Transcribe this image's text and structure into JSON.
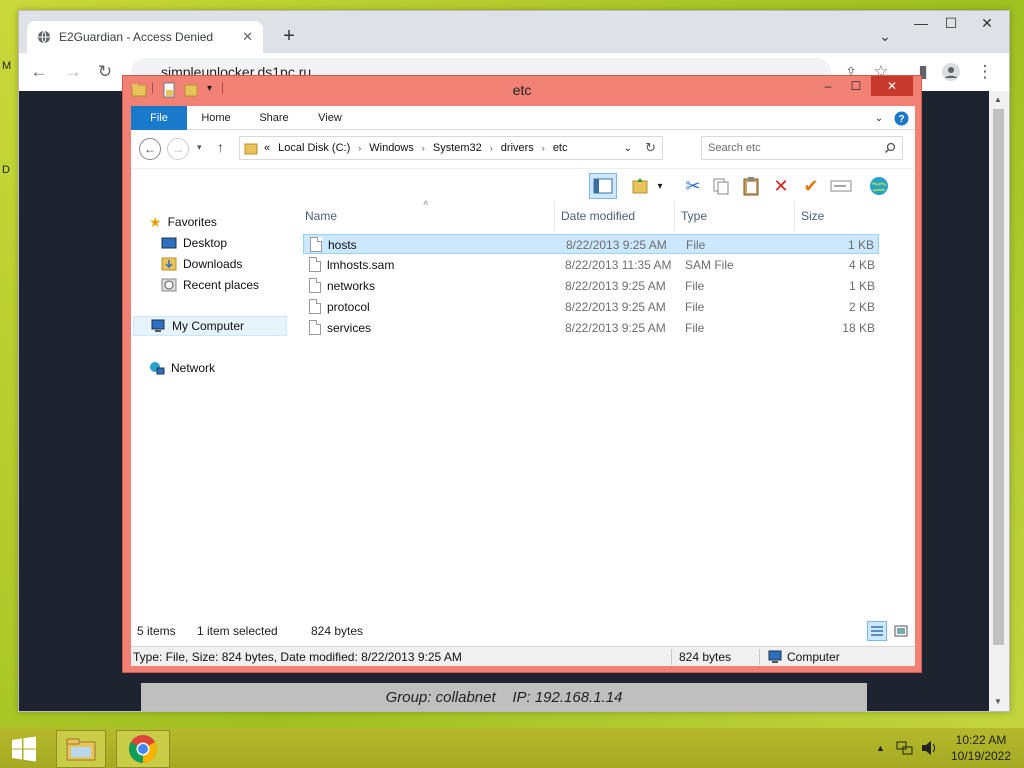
{
  "desktop": {
    "left_labels": [
      "M",
      "D"
    ]
  },
  "browser": {
    "tab_title": "E2Guardian - Access Denied",
    "url": "simpleunlocker.ds1pc.ru",
    "page_banner": "Group: collabnet    IP: 192.168.1.14"
  },
  "explorer": {
    "title": "etc",
    "ribbon_tabs": [
      "File",
      "Home",
      "Share",
      "View"
    ],
    "breadcrumb": [
      "«",
      "Local Disk (C:)",
      "Windows",
      "System32",
      "drivers",
      "etc"
    ],
    "search_placeholder": "Search etc",
    "nav": {
      "favorites": "Favorites",
      "desktop": "Desktop",
      "downloads": "Downloads",
      "recent": "Recent places",
      "computer": "My Computer",
      "network": "Network"
    },
    "columns": {
      "name": "Name",
      "date": "Date modified",
      "type": "Type",
      "size": "Size"
    },
    "files": [
      {
        "name": "hosts",
        "date": "8/22/2013 9:25 AM",
        "type": "File",
        "size": "1 KB"
      },
      {
        "name": "lmhosts.sam",
        "date": "8/22/2013 11:35 AM",
        "type": "SAM File",
        "size": "4 KB"
      },
      {
        "name": "networks",
        "date": "8/22/2013 9:25 AM",
        "type": "File",
        "size": "1 KB"
      },
      {
        "name": "protocol",
        "date": "8/22/2013 9:25 AM",
        "type": "File",
        "size": "2 KB"
      },
      {
        "name": "services",
        "date": "8/22/2013 9:25 AM",
        "type": "File",
        "size": "18 KB"
      }
    ],
    "status": {
      "items": "5 items",
      "selected": "1 item selected",
      "selected_size": "824 bytes",
      "detail": "Type: File, Size: 824 bytes, Date modified: 8/22/2013 9:25 AM",
      "bytes": "824 bytes",
      "location": "Computer"
    }
  },
  "taskbar": {
    "time": "10:22 AM",
    "date": "10/19/2022"
  },
  "colors": {
    "explorer_frame": "#f08174",
    "selection": "#cce8ff",
    "ribbon_file": "#1979ca",
    "close_button": "#c7392a"
  }
}
